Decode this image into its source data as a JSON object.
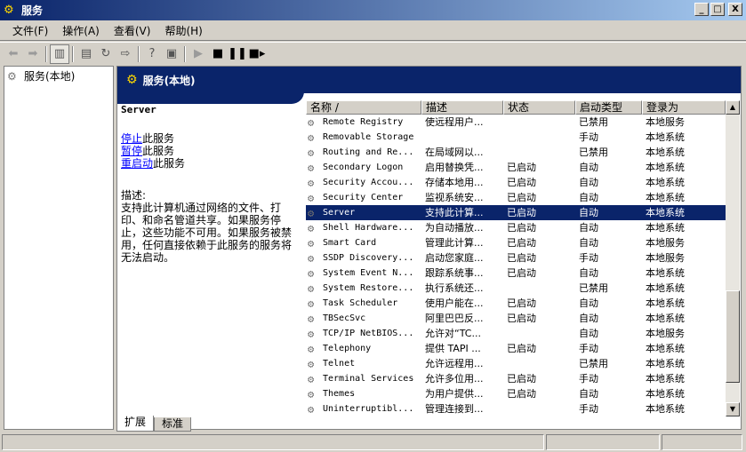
{
  "window": {
    "title": "服务"
  },
  "window_buttons": {
    "minimize": "_",
    "maximize": "□",
    "close": "X"
  },
  "menu": [
    "文件(F)",
    "操作(A)",
    "查看(V)",
    "帮助(H)"
  ],
  "tree": {
    "root": "服务(本地)"
  },
  "header": {
    "title": "服务(本地)"
  },
  "details": {
    "selected_name": "Server",
    "actions": [
      {
        "link": "停止",
        "suffix": "此服务"
      },
      {
        "link": "暂停",
        "suffix": "此服务"
      },
      {
        "link": "重启动",
        "suffix": "此服务"
      }
    ],
    "description_label": "描述:",
    "description": "支持此计算机通过网络的文件、打印、和命名管道共享。如果服务停止，这些功能不可用。如果服务被禁用，任何直接依赖于此服务的服务将无法启动。"
  },
  "columns": [
    "名称  /",
    "描述",
    "状态",
    "启动类型",
    "登录为"
  ],
  "rows": [
    {
      "name": "Remote Registry",
      "desc": "使远程用户...",
      "status": "",
      "startup": "已禁用",
      "logon": "本地服务"
    },
    {
      "name": "Removable Storage",
      "desc": "",
      "status": "",
      "startup": "手动",
      "logon": "本地系统"
    },
    {
      "name": "Routing and Re...",
      "desc": "在局域网以...",
      "status": "",
      "startup": "已禁用",
      "logon": "本地系统"
    },
    {
      "name": "Secondary Logon",
      "desc": "启用替换凭...",
      "status": "已启动",
      "startup": "自动",
      "logon": "本地系统"
    },
    {
      "name": "Security Accou...",
      "desc": "存储本地用...",
      "status": "已启动",
      "startup": "自动",
      "logon": "本地系统"
    },
    {
      "name": "Security Center",
      "desc": "监视系统安...",
      "status": "已启动",
      "startup": "自动",
      "logon": "本地系统"
    },
    {
      "name": "Server",
      "desc": "支持此计算...",
      "status": "已启动",
      "startup": "自动",
      "logon": "本地系统",
      "selected": true
    },
    {
      "name": "Shell Hardware...",
      "desc": "为自动播放...",
      "status": "已启动",
      "startup": "自动",
      "logon": "本地系统"
    },
    {
      "name": "Smart Card",
      "desc": "管理此计算...",
      "status": "已启动",
      "startup": "自动",
      "logon": "本地服务"
    },
    {
      "name": "SSDP Discovery...",
      "desc": "启动您家庭...",
      "status": "已启动",
      "startup": "手动",
      "logon": "本地服务"
    },
    {
      "name": "System Event N...",
      "desc": "跟踪系统事...",
      "status": "已启动",
      "startup": "自动",
      "logon": "本地系统"
    },
    {
      "name": "System Restore...",
      "desc": "执行系统还...",
      "status": "",
      "startup": "已禁用",
      "logon": "本地系统"
    },
    {
      "name": "Task Scheduler",
      "desc": "使用户能在...",
      "status": "已启动",
      "startup": "自动",
      "logon": "本地系统"
    },
    {
      "name": "TBSecSvc",
      "desc": "阿里巴巴反...",
      "status": "已启动",
      "startup": "自动",
      "logon": "本地系统"
    },
    {
      "name": "TCP/IP NetBIOS...",
      "desc": "允许对“TC...",
      "status": "",
      "startup": "自动",
      "logon": "本地服务"
    },
    {
      "name": "Telephony",
      "desc": "提供 TAPI ...",
      "status": "已启动",
      "startup": "手动",
      "logon": "本地系统"
    },
    {
      "name": "Telnet",
      "desc": "允许远程用...",
      "status": "",
      "startup": "已禁用",
      "logon": "本地系统"
    },
    {
      "name": "Terminal Services",
      "desc": "允许多位用...",
      "status": "已启动",
      "startup": "手动",
      "logon": "本地系统"
    },
    {
      "name": "Themes",
      "desc": "为用户提供...",
      "status": "已启动",
      "startup": "自动",
      "logon": "本地系统"
    },
    {
      "name": "Uninterruptibl...",
      "desc": "管理连接到...",
      "status": "",
      "startup": "手动",
      "logon": "本地系统"
    }
  ],
  "tabs": [
    "扩展",
    "标准"
  ],
  "scrollbar": {
    "up": "▲",
    "down": "▼"
  },
  "icons": {
    "app": "gears-icon",
    "back": "back-arrow-icon",
    "forward": "forward-arrow-icon",
    "show_tree": "console-tree-icon",
    "properties": "properties-icon",
    "refresh": "refresh-icon",
    "export": "export-list-icon",
    "help": "help-icon",
    "view": "view-icon",
    "start": "start-icon",
    "stop": "stop-icon",
    "pause": "pause-icon",
    "restart": "restart-icon",
    "service": "service-gear-icon"
  },
  "colors": {
    "title_bar": "#0a246a",
    "header_band": "#0a246a",
    "selection": "#0a246a",
    "link": "#0000ff"
  }
}
